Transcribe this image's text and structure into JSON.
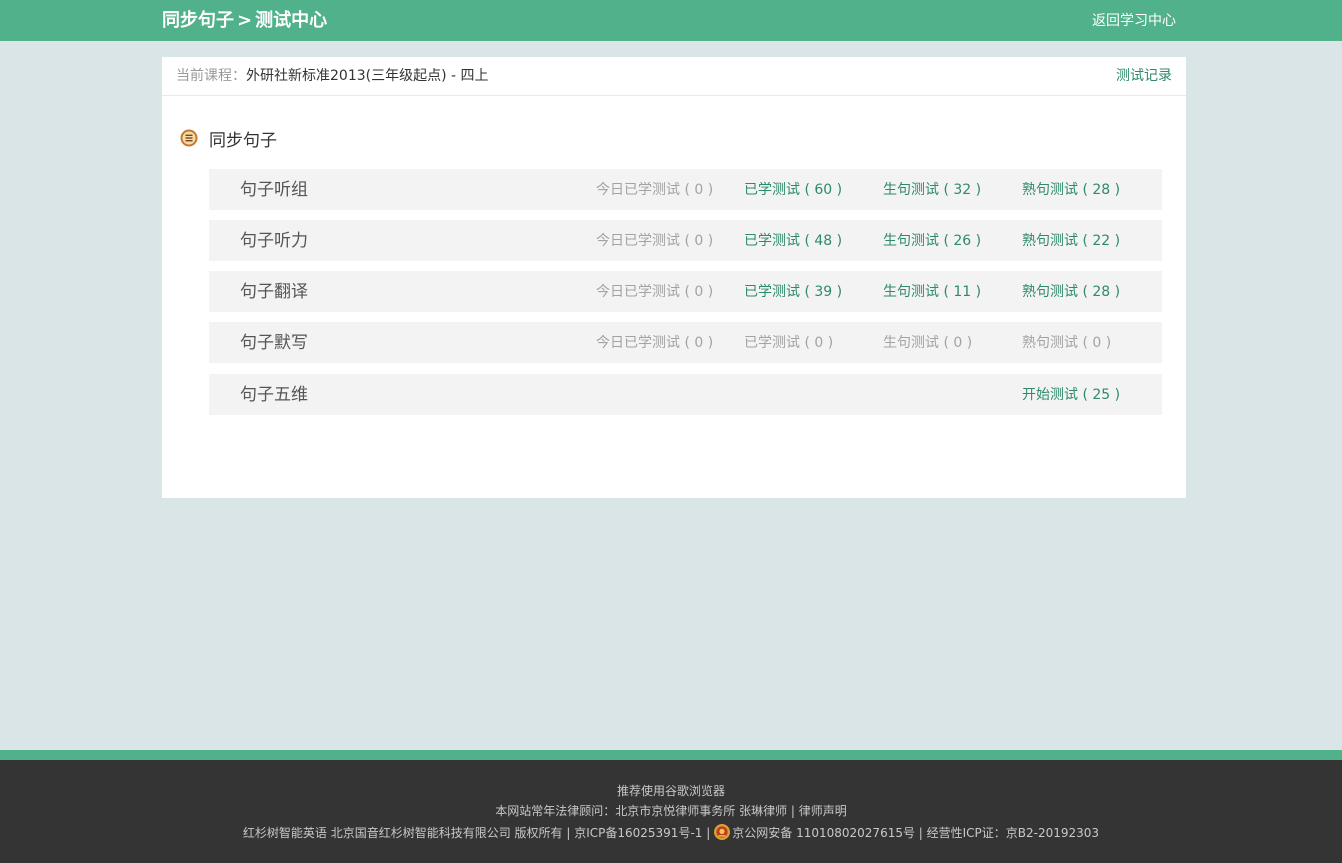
{
  "header": {
    "title_part1": "同步句子",
    "title_sep": ">",
    "title_part2": "测试中心",
    "back_link": "返回学习中心"
  },
  "course_bar": {
    "label": "当前课程：",
    "value": "外研社新标准2013(三年级起点) - 四上",
    "record_link": "测试记录"
  },
  "section": {
    "title": "同步句子",
    "icon": "list-circle-icon"
  },
  "rows": [
    {
      "name": "句子听组",
      "today": "今日已学测试 ( 0 )",
      "learned": "已学测试 ( 60 )",
      "new_sent": "生句测试 ( 32 )",
      "familiar": "熟句测试 ( 28 )"
    },
    {
      "name": "句子听力",
      "today": "今日已学测试 ( 0 )",
      "learned": "已学测试 ( 48 )",
      "new_sent": "生句测试 ( 26 )",
      "familiar": "熟句测试 ( 22 )"
    },
    {
      "name": "句子翻译",
      "today": "今日已学测试 ( 0 )",
      "learned": "已学测试 ( 39 )",
      "new_sent": "生句测试 ( 11 )",
      "familiar": "熟句测试 ( 28 )"
    },
    {
      "name": "句子默写",
      "today": "今日已学测试 ( 0 )",
      "learned": "已学测试 ( 0 )",
      "new_sent": "生句测试 ( 0 )",
      "familiar": "熟句测试 ( 0 )"
    },
    {
      "name": "句子五维",
      "start": "开始测试 ( 25 )"
    }
  ],
  "footer": {
    "line1": "推荐使用谷歌浏览器",
    "line2": "本网站常年法律顾问：北京市京悦律师事务所 张琳律师 | 律师声明",
    "line3_pre": "红杉树智能英语 北京国音红杉树智能科技有限公司 版权所有 | 京ICP备16025391号-1 |",
    "line3_post": "京公网安备 11010802027615号 | 经营性ICP证：京B2-20192303"
  },
  "colors": {
    "brand_green": "#50b18a",
    "link_green": "#2e8a68",
    "page_bg": "#d9e5e6",
    "footer_bg": "#343434",
    "muted_text": "#a3a3a3"
  }
}
